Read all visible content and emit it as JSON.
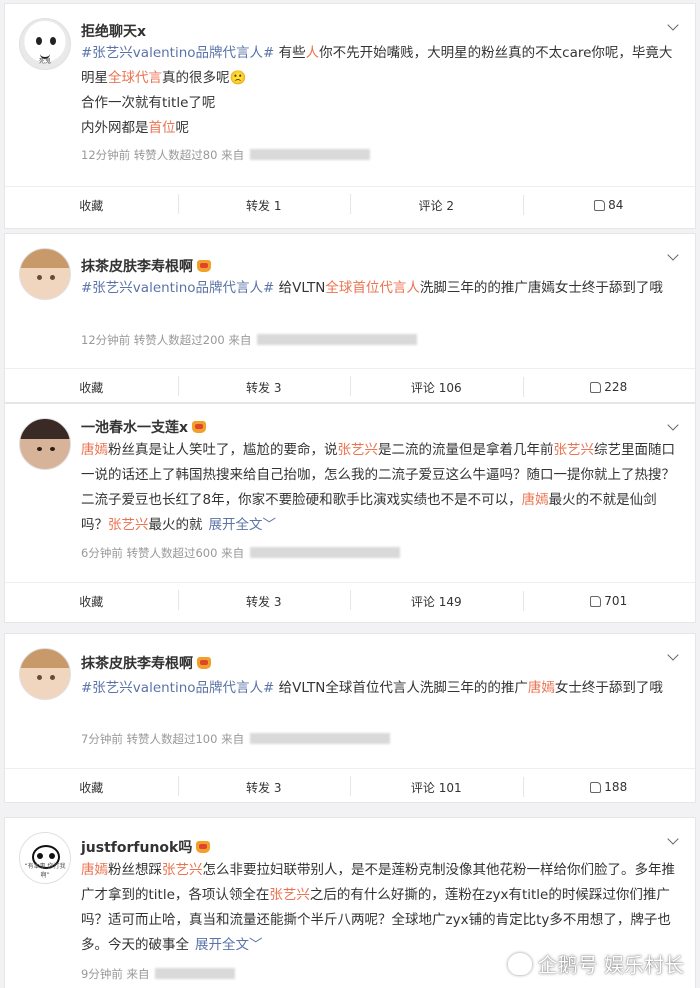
{
  "posts": [
    {
      "username": "拒绝聊天x",
      "avatar_caption": "死鬼",
      "lines": [
        [
          {
            "t": "#张艺兴valentino品牌代言人#",
            "c": "tag"
          },
          {
            "t": " 有些"
          },
          {
            "t": "人",
            "c": "hl"
          },
          {
            "t": "你不先开始嘴贱，大明星的粉丝真的不太care你呢，毕竟大明星"
          },
          {
            "t": "全球代言",
            "c": "hl"
          },
          {
            "t": "真的很多呢🙁"
          }
        ],
        [
          {
            "t": "合作一次就有title了呢"
          }
        ],
        [
          {
            "t": "内外网都是"
          },
          {
            "t": "首位",
            "c": "hl"
          },
          {
            "t": "呢"
          }
        ]
      ],
      "meta": "12分钟前  转赞人数超过80  来自",
      "actions": {
        "fav": "收藏",
        "repost": "转发 1",
        "comment": "评论 2",
        "like": "84"
      }
    },
    {
      "username": "抹茶皮肤李寿根啊",
      "lines": [
        [
          {
            "t": "#张艺兴valentino品牌代言人#",
            "c": "tag"
          },
          {
            "t": " 给VLTN"
          },
          {
            "t": "全球首位代言人",
            "c": "hl"
          },
          {
            "t": "洗脚三年的的推广唐嫣女士终于舔到了哦"
          }
        ]
      ],
      "meta": "12分钟前  转赞人数超过200  来自",
      "actions": {
        "fav": "收藏",
        "repost": "转发 3",
        "comment": "评论 106",
        "like": "228"
      }
    },
    {
      "username": "一池春水一支莲x",
      "lines": [
        [
          {
            "t": "唐嫣",
            "c": "hl"
          },
          {
            "t": "粉丝真是让人笑吐了，尴尬的要命，说"
          },
          {
            "t": "张艺兴",
            "c": "hl"
          },
          {
            "t": "是二流的流量但是拿着几年前"
          },
          {
            "t": "张艺兴",
            "c": "hl"
          },
          {
            "t": "综艺里面随口一说的话还上了韩国热搜来给自己抬咖，怎么我的二流子爱豆这么牛逼吗？随口一提你就上了热搜？二流子爱豆也长红了8年，你家不要脸硬和歌手比演戏实绩也不是不可以，"
          },
          {
            "t": "唐嫣",
            "c": "hl"
          },
          {
            "t": "最火的不就是仙剑吗？"
          },
          {
            "t": "张艺兴",
            "c": "hl"
          },
          {
            "t": "最火的就"
          },
          {
            "t": "展开全文﹀",
            "c": "expand"
          }
        ]
      ],
      "meta": "6分钟前  转赞人数超过600  来自",
      "actions": {
        "fav": "收藏",
        "repost": "转发 3",
        "comment": "评论 149",
        "like": "701"
      }
    },
    {
      "username": "抹茶皮肤李寿根啊",
      "lines": [
        [
          {
            "t": "#张艺兴valentino品牌代言人#",
            "c": "tag"
          },
          {
            "t": " 给VLTN全球首位代言人洗脚三年的的推广"
          },
          {
            "t": "唐嫣",
            "c": "hl"
          },
          {
            "t": "女士终于舔到了哦"
          }
        ]
      ],
      "meta": "7分钟前  转赞人数超过100  来自",
      "actions": {
        "fav": "收藏",
        "repost": "转发 3",
        "comment": "评论 101",
        "like": "188"
      }
    },
    {
      "username": "justforfunok吗",
      "avatar_caption": "“有本事 你打我啊”",
      "lines": [
        [
          {
            "t": "唐嫣",
            "c": "hl"
          },
          {
            "t": "粉丝想踩"
          },
          {
            "t": "张艺兴",
            "c": "hl"
          },
          {
            "t": "怎么非要拉妇联带别人，是不是莲粉克制没像其他花粉一样给你们脸了。多年推广才拿到的title，各项认领全在"
          },
          {
            "t": "张艺兴",
            "c": "hl"
          },
          {
            "t": "之后的有什么好撕的，莲粉在zyx有title的时候踩过你们推广吗？适可而止哈，真当和流量还能撕个半斤八两呢？全球地广zyx铺的肯定比ty多不用想了，牌子也多。今天的破事全"
          },
          {
            "t": "展开全文﹀",
            "c": "expand"
          }
        ]
      ],
      "meta": "9分钟前  来自",
      "actions": null
    }
  ],
  "watermark": "企鹅号 娱乐村长",
  "colors": {
    "highlight": "#eb7350",
    "topic": "#5a74a8",
    "meta": "#999999"
  }
}
